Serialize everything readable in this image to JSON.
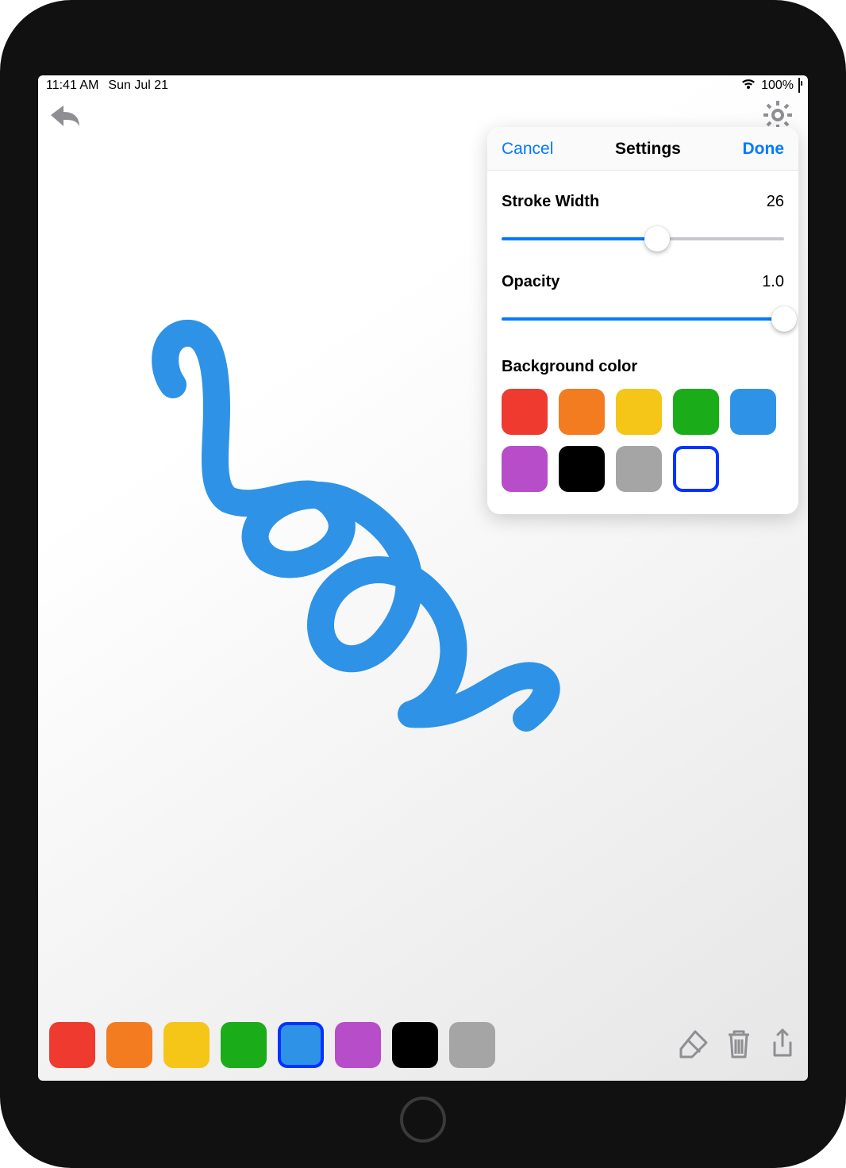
{
  "status": {
    "time": "11:41 AM",
    "date": "Sun Jul 21",
    "battery_pct": "100%"
  },
  "popover": {
    "cancel": "Cancel",
    "title": "Settings",
    "done": "Done",
    "stroke_label": "Stroke Width",
    "stroke_value": "26",
    "stroke_slider_percent": 55,
    "opacity_label": "Opacity",
    "opacity_value": "1.0",
    "opacity_slider_percent": 100,
    "bg_label": "Background color",
    "bg_colors": [
      {
        "name": "red",
        "hex": "#ef3a2f"
      },
      {
        "name": "orange",
        "hex": "#f47c20"
      },
      {
        "name": "yellow",
        "hex": "#f5c518"
      },
      {
        "name": "green",
        "hex": "#1aad19"
      },
      {
        "name": "blue",
        "hex": "#2e93e6"
      },
      {
        "name": "purple",
        "hex": "#b84dc9"
      },
      {
        "name": "black",
        "hex": "#000000"
      },
      {
        "name": "gray",
        "hex": "#a5a5a5"
      },
      {
        "name": "white",
        "hex": "#ffffff",
        "selected": true
      }
    ]
  },
  "toolbar_colors": [
    {
      "name": "red",
      "hex": "#ef3a2f"
    },
    {
      "name": "orange",
      "hex": "#f47c20"
    },
    {
      "name": "yellow",
      "hex": "#f5c518"
    },
    {
      "name": "green",
      "hex": "#1aad19"
    },
    {
      "name": "blue",
      "hex": "#2e93e6",
      "selected": true
    },
    {
      "name": "purple",
      "hex": "#b84dc9"
    },
    {
      "name": "black",
      "hex": "#000000"
    },
    {
      "name": "gray",
      "hex": "#a5a5a5"
    }
  ],
  "stroke_color": "#2e93e6"
}
